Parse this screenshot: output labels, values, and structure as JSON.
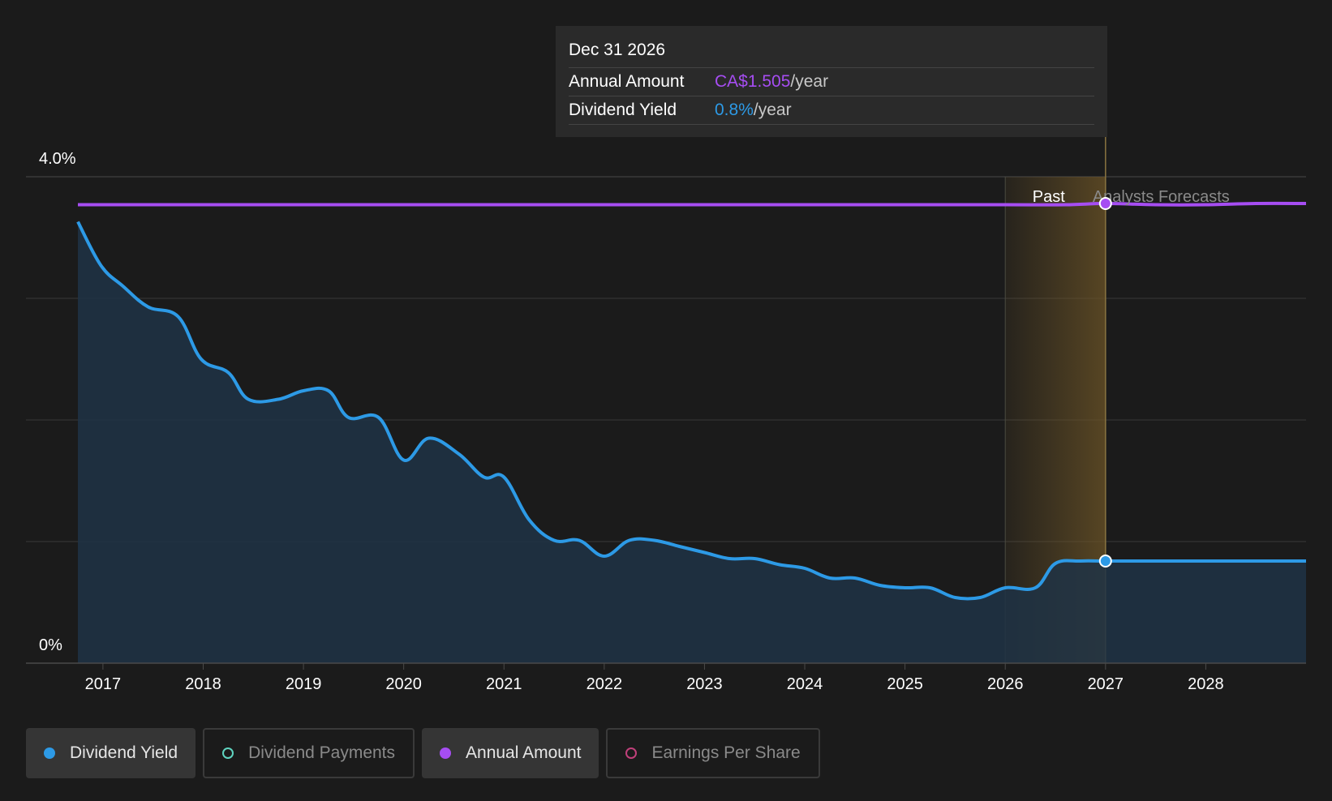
{
  "tooltip": {
    "date": "Dec 31 2026",
    "annual_label": "Annual Amount",
    "annual_value": "CA$1.505",
    "annual_unit": "/year",
    "yield_label": "Dividend Yield",
    "yield_value": "0.8%",
    "yield_unit": "/year"
  },
  "legend": [
    {
      "label": "Dividend Yield",
      "color": "#2d9ae6",
      "active": true
    },
    {
      "label": "Dividend Payments",
      "color": "#5fd4c0",
      "active": false
    },
    {
      "label": "Annual Amount",
      "color": "#a64df2",
      "active": true
    },
    {
      "label": "Earnings Per Share",
      "color": "#c0407a",
      "active": false
    }
  ],
  "colors": {
    "yield": "#2d9ae6",
    "annual": "#a64df2",
    "grid": "#3a3a3a",
    "highlight": "#6b5326"
  },
  "chart_data": {
    "type": "line",
    "y_ticks": [
      "4.0%",
      "0%"
    ],
    "ylim": [
      0,
      4.0
    ],
    "xlim": [
      2016.75,
      2029.0
    ],
    "x_ticks": [
      "2017",
      "2018",
      "2019",
      "2020",
      "2021",
      "2022",
      "2023",
      "2024",
      "2025",
      "2026",
      "2027",
      "2028"
    ],
    "region_labels": {
      "past": "Past",
      "forecast": "Analysts Forecasts"
    },
    "highlight_range": [
      2026.0,
      2027.0
    ],
    "selected_x": 2027.0,
    "grid": true,
    "series": [
      {
        "name": "Dividend Yield",
        "x": [
          2016.75,
          2016.98,
          2017.2,
          2017.45,
          2017.75,
          2017.98,
          2018.25,
          2018.45,
          2018.75,
          2019.0,
          2019.25,
          2019.45,
          2019.75,
          2020.0,
          2020.25,
          2020.55,
          2020.8,
          2021.0,
          2021.25,
          2021.5,
          2021.75,
          2022.0,
          2022.25,
          2022.5,
          2022.75,
          2023.0,
          2023.25,
          2023.5,
          2023.75,
          2024.0,
          2024.25,
          2024.5,
          2024.75,
          2025.0,
          2025.25,
          2025.5,
          2025.75,
          2026.0,
          2026.3,
          2026.5,
          2026.75,
          2027.0,
          2027.5,
          2028.0,
          2028.5,
          2029.0
        ],
        "y": [
          3.63,
          3.27,
          3.1,
          2.93,
          2.85,
          2.5,
          2.39,
          2.17,
          2.17,
          2.24,
          2.24,
          2.02,
          2.02,
          1.67,
          1.85,
          1.72,
          1.53,
          1.53,
          1.18,
          1.01,
          1.01,
          0.88,
          1.01,
          1.01,
          0.96,
          0.91,
          0.86,
          0.86,
          0.81,
          0.78,
          0.7,
          0.7,
          0.64,
          0.62,
          0.62,
          0.54,
          0.54,
          0.62,
          0.62,
          0.82,
          0.84,
          0.84,
          0.84,
          0.84,
          0.84,
          0.84
        ]
      },
      {
        "name": "Annual Amount",
        "x": [
          2016.75,
          2017.0,
          2018.0,
          2019.0,
          2020.0,
          2021.0,
          2022.0,
          2023.0,
          2024.0,
          2025.0,
          2026.0,
          2026.6,
          2027.0,
          2027.5,
          2028.0,
          2028.5,
          2029.0
        ],
        "y": [
          3.77,
          3.77,
          3.77,
          3.77,
          3.77,
          3.77,
          3.77,
          3.77,
          3.77,
          3.77,
          3.77,
          3.77,
          3.78,
          3.77,
          3.77,
          3.78,
          3.78
        ]
      }
    ]
  }
}
